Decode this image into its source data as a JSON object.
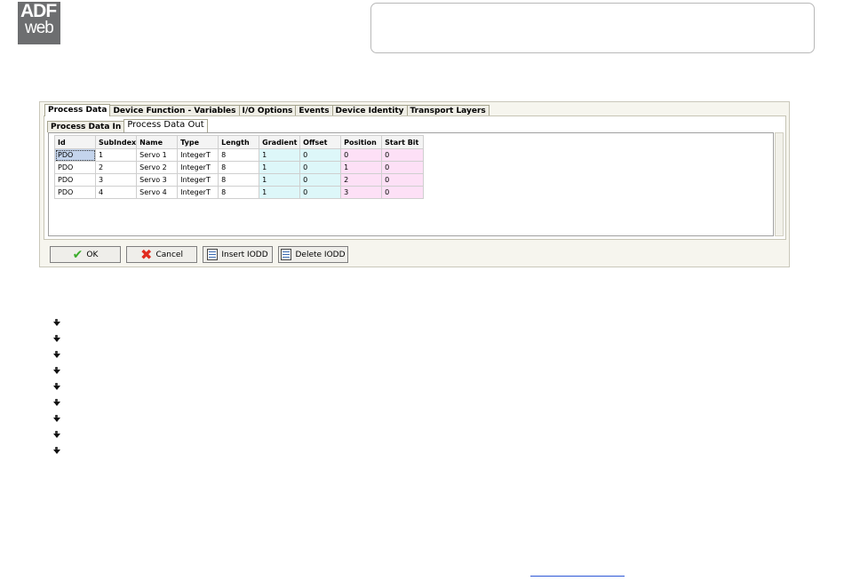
{
  "logo": {
    "line1": "ADF",
    "line2": "web"
  },
  "window": {
    "tabs": [
      {
        "label": "Process Data",
        "active": true
      },
      {
        "label": "Device Function - Variables",
        "active": false
      },
      {
        "label": "I/O Options",
        "active": false
      },
      {
        "label": "Events",
        "active": false
      },
      {
        "label": "Device Identity",
        "active": false
      },
      {
        "label": "Transport Layers",
        "active": false
      }
    ],
    "subtabs": [
      {
        "label": "Process Data In",
        "active": false
      },
      {
        "label": "Process Data Out",
        "active": true
      }
    ],
    "table": {
      "columns": [
        "Id",
        "SubIndex",
        "Name",
        "Type",
        "Length",
        "Gradient",
        "Offset",
        "Position",
        "Start Bit"
      ],
      "rows": [
        [
          "PDO",
          "1",
          "Servo 1",
          "IntegerT",
          "8",
          "1",
          "0",
          "0",
          "0"
        ],
        [
          "PDO",
          "2",
          "Servo 2",
          "IntegerT",
          "8",
          "1",
          "0",
          "1",
          "0"
        ],
        [
          "PDO",
          "3",
          "Servo 3",
          "IntegerT",
          "8",
          "1",
          "0",
          "2",
          "0"
        ],
        [
          "PDO",
          "4",
          "Servo 4",
          "IntegerT",
          "8",
          "1",
          "0",
          "3",
          "0"
        ]
      ]
    },
    "buttons": {
      "ok": "OK",
      "cancel": "Cancel",
      "insert": "Insert IODD",
      "delete": "Delete IODD"
    }
  },
  "colors": {
    "cyan_columns": "#ddf7f9",
    "pink_columns": "#fde0f6",
    "selected_cell": "#c4d4ec"
  },
  "bullet_count": 9
}
